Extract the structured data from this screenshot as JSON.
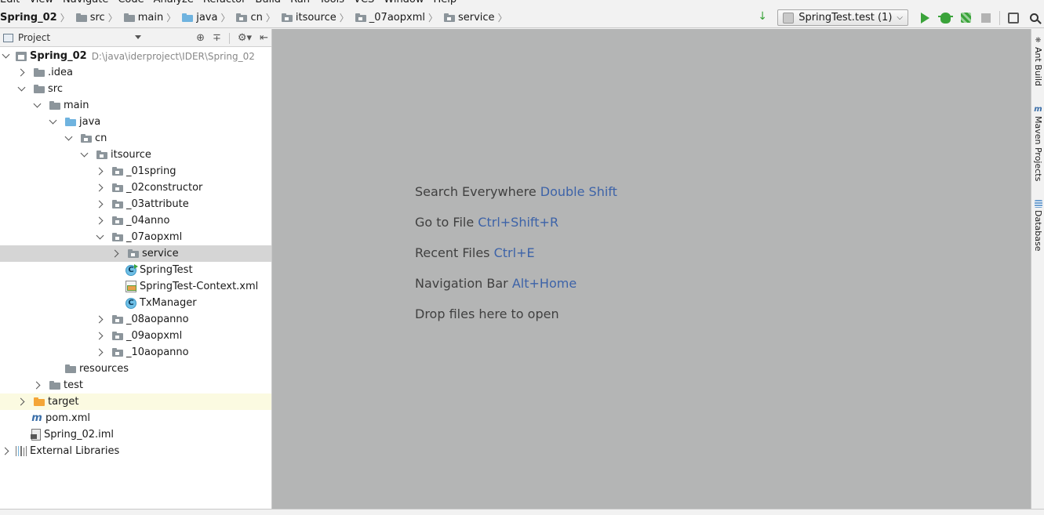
{
  "menubar": {
    "items": [
      "Edit",
      "View",
      "Navigate",
      "Code",
      "Analyze",
      "Refactor",
      "Build",
      "Run",
      "Tools",
      "VCS",
      "Window",
      "Help"
    ]
  },
  "navbar": {
    "breadcrumbs": [
      {
        "label": "Spring_02",
        "icon": "project-icon"
      },
      {
        "label": "src",
        "icon": "folder-icon"
      },
      {
        "label": "main",
        "icon": "folder-icon"
      },
      {
        "label": "java",
        "icon": "source-folder-icon"
      },
      {
        "label": "cn",
        "icon": "package-icon"
      },
      {
        "label": "itsource",
        "icon": "package-icon"
      },
      {
        "label": "_07aopxml",
        "icon": "package-icon"
      },
      {
        "label": "service",
        "icon": "package-icon"
      }
    ],
    "run_config": "SpringTest.test (1)"
  },
  "project_panel": {
    "title": "Project",
    "tree": [
      {
        "label": "Spring_02",
        "path": "D:\\java\\iderproject\\IDER\\Spring_02",
        "depth": 0,
        "arrow": "down",
        "icon": "project"
      },
      {
        "label": ".idea",
        "depth": 1,
        "arrow": "right",
        "icon": "folder"
      },
      {
        "label": "src",
        "depth": 1,
        "arrow": "down",
        "icon": "folder"
      },
      {
        "label": "main",
        "depth": 2,
        "arrow": "down",
        "icon": "folder"
      },
      {
        "label": "java",
        "depth": 3,
        "arrow": "down",
        "icon": "source-folder"
      },
      {
        "label": "cn",
        "depth": 4,
        "arrow": "down",
        "icon": "package"
      },
      {
        "label": "itsource",
        "depth": 5,
        "arrow": "down",
        "icon": "package"
      },
      {
        "label": "_01spring",
        "depth": 6,
        "arrow": "right",
        "icon": "package"
      },
      {
        "label": "_02constructor",
        "depth": 6,
        "arrow": "right",
        "icon": "package"
      },
      {
        "label": "_03attribute",
        "depth": 6,
        "arrow": "right",
        "icon": "package"
      },
      {
        "label": "_04anno",
        "depth": 6,
        "arrow": "right",
        "icon": "package"
      },
      {
        "label": "_07aopxml",
        "depth": 6,
        "arrow": "down",
        "icon": "package"
      },
      {
        "label": "service",
        "depth": 7,
        "arrow": "right",
        "icon": "package",
        "selected": true
      },
      {
        "label": "SpringTest",
        "depth": 7,
        "arrow": "none",
        "icon": "class-run"
      },
      {
        "label": "SpringTest-Context.xml",
        "depth": 7,
        "arrow": "none",
        "icon": "xml"
      },
      {
        "label": "TxManager",
        "depth": 7,
        "arrow": "none",
        "icon": "class"
      },
      {
        "label": "_08aopanno",
        "depth": 6,
        "arrow": "right",
        "icon": "package"
      },
      {
        "label": "_09aopxml",
        "depth": 6,
        "arrow": "right",
        "icon": "package"
      },
      {
        "label": "_10aopanno",
        "depth": 6,
        "arrow": "right",
        "icon": "package"
      },
      {
        "label": "resources",
        "depth": 3,
        "arrow": "none",
        "icon": "resources-folder"
      },
      {
        "label": "test",
        "depth": 2,
        "arrow": "right",
        "icon": "folder"
      },
      {
        "label": "target",
        "depth": 1,
        "arrow": "right",
        "icon": "excluded-folder",
        "highlight": true
      },
      {
        "label": "pom.xml",
        "depth": 1,
        "arrow": "none",
        "icon": "maven"
      },
      {
        "label": "Spring_02.iml",
        "depth": 1,
        "arrow": "none",
        "icon": "iml"
      },
      {
        "label": "External Libraries",
        "depth": 0,
        "arrow": "right",
        "icon": "libraries"
      }
    ]
  },
  "editor": {
    "hints": [
      {
        "text": "Search Everywhere",
        "key": "Double Shift"
      },
      {
        "text": "Go to File",
        "key": "Ctrl+Shift+R"
      },
      {
        "text": "Recent Files",
        "key": "Ctrl+E"
      },
      {
        "text": "Navigation Bar",
        "key": "Alt+Home"
      },
      {
        "text": "Drop files here to open",
        "key": ""
      }
    ]
  },
  "right_strip": {
    "tabs": [
      "Ant Build",
      "Maven Projects",
      "Database"
    ]
  }
}
